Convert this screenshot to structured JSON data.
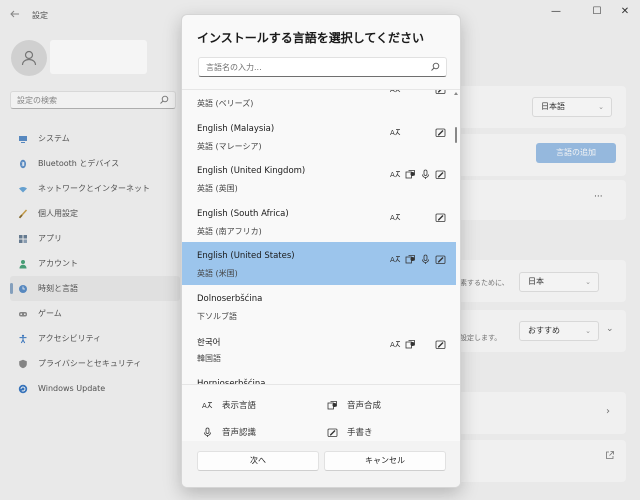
{
  "window": {
    "title": "設定",
    "controls": {
      "minimize": "—",
      "maximize": "☐",
      "close": "✕"
    }
  },
  "sidebar": {
    "search_placeholder": "設定の検索",
    "items": [
      {
        "label": "システム",
        "icon": "monitor-icon"
      },
      {
        "label": "Bluetooth とデバイス",
        "icon": "bluetooth-icon"
      },
      {
        "label": "ネットワークとインターネット",
        "icon": "wifi-icon"
      },
      {
        "label": "個人用設定",
        "icon": "brush-icon"
      },
      {
        "label": "アプリ",
        "icon": "apps-icon"
      },
      {
        "label": "アカウント",
        "icon": "person-icon"
      },
      {
        "label": "時刻と言語",
        "icon": "globe-clock-icon",
        "active": true
      },
      {
        "label": "ゲーム",
        "icon": "gamepad-icon"
      },
      {
        "label": "アクセシビリティ",
        "icon": "accessibility-icon"
      },
      {
        "label": "プライバシーとセキュリティ",
        "icon": "shield-icon"
      },
      {
        "label": "Windows Update",
        "icon": "update-icon"
      }
    ]
  },
  "background": {
    "display_language_select": "日本語",
    "add_language_button": "言語の追加",
    "more_options": "···",
    "region_snippet": "素するために、",
    "region_select": "日本",
    "format_snippet": "設定します。",
    "format_select": "おすすめ"
  },
  "dialog": {
    "title": "インストールする言語を選択してください",
    "search_placeholder": "言語名の入力...",
    "languages": [
      {
        "name": "",
        "native": "英語 (ベリーズ)",
        "features": [
          "display",
          "handwriting"
        ],
        "selected": false
      },
      {
        "name": "English (Malaysia)",
        "native": "英語 (マレーシア)",
        "features": [
          "display",
          "handwriting"
        ],
        "selected": false
      },
      {
        "name": "English (United Kingdom)",
        "native": "英語 (英国)",
        "features": [
          "display",
          "tts",
          "speech",
          "handwriting"
        ],
        "selected": false
      },
      {
        "name": "English (South Africa)",
        "native": "英語 (南アフリカ)",
        "features": [
          "display",
          "handwriting"
        ],
        "selected": false
      },
      {
        "name": "English (United States)",
        "native": "英語 (米国)",
        "features": [
          "display",
          "tts",
          "speech",
          "handwriting"
        ],
        "selected": true
      },
      {
        "name": "Dolnoserbšćina",
        "native": "下ソルブ語",
        "features": [],
        "selected": false
      },
      {
        "name": "한국어",
        "native": "韓国語",
        "features": [
          "display",
          "tts",
          "handwriting"
        ],
        "selected": false
      },
      {
        "name": "Hornjoserbšćina",
        "native": "",
        "features": [],
        "selected": false
      }
    ],
    "legend": {
      "display": "表示言語",
      "tts": "音声合成",
      "speech": "音声認識",
      "handwriting": "手書き"
    },
    "next_button": "次へ",
    "cancel_button": "キャンセル"
  },
  "colors": {
    "accent": "#9cc0e6",
    "selected_row": "#9cc5ec",
    "window_bg": "#f3f3f3"
  }
}
